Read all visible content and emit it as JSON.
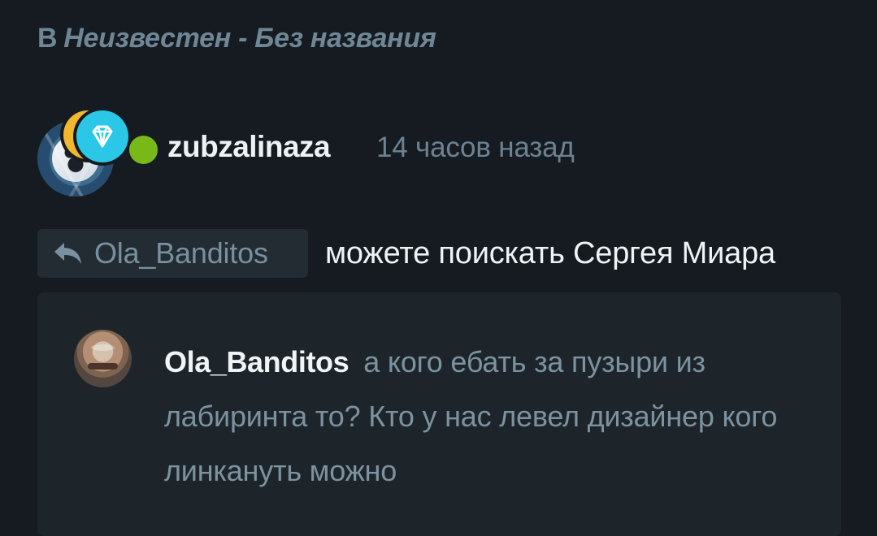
{
  "breadcrumb": {
    "prefix": "В",
    "text": "Неизвестен - Без названия"
  },
  "comment": {
    "author": "zubzalinaza",
    "timestamp": "14 часов назад",
    "online_status_color": "#79b917",
    "avatar_badges": [
      "gold-badge",
      "diamond-badge"
    ],
    "reply_to": "Ola_Banditos",
    "message": "можете поискать Сергея Миара"
  },
  "quoted": {
    "author": "Ola_Banditos",
    "text": "а кого ебать за пузыри из лабиринта то? Кто у нас левел дизайнер кого линкануть можно"
  },
  "colors": {
    "background": "#151b20",
    "card": "#1d252b",
    "chip": "#232c33",
    "accent_muted": "#6f8695",
    "diamond": "#2ac7e6",
    "gold": "#f0b72f"
  }
}
